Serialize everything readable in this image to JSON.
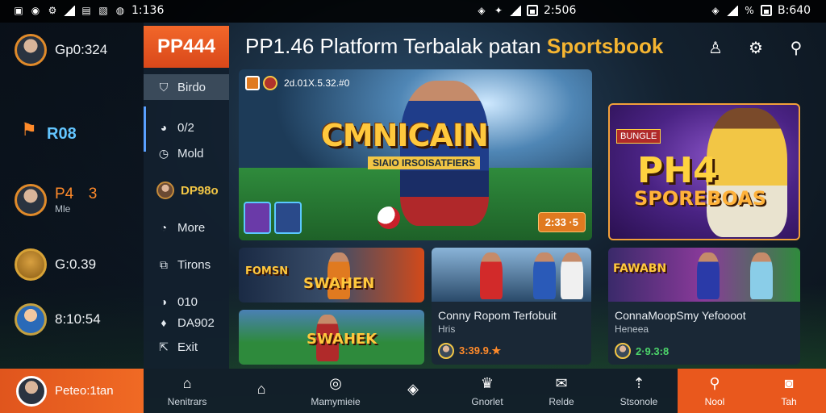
{
  "status_bar": {
    "left_time": "1:136",
    "mid_time": "2:506",
    "right_time": "B:640"
  },
  "left_rail": {
    "items": [
      {
        "value": "Gp0:324",
        "style": "plain"
      },
      {
        "value": "R08",
        "style": "amount"
      },
      {
        "value": "P4",
        "value2": "3",
        "sub": "Mle",
        "style": "orange"
      },
      {
        "value": "G:0.39",
        "style": "plain"
      },
      {
        "value": "8:10:54",
        "style": "plain"
      }
    ],
    "bottom_user": "Peteo:1tan"
  },
  "menu": {
    "brand": "PP444",
    "items": [
      {
        "label": "Birdo",
        "icon": "shield-icon"
      },
      {
        "label": "0/2",
        "icon": "chat-icon"
      },
      {
        "label": "Mold",
        "icon": "clock-icon"
      },
      {
        "label": "DP98o",
        "icon": "avatar-icon"
      },
      {
        "label": "More",
        "icon": "dots-icon"
      },
      {
        "label": "Tirons",
        "icon": "ticket-icon"
      },
      {
        "label": "010",
        "icon": "gift-icon"
      },
      {
        "label": "DA902",
        "icon": "bell-icon"
      },
      {
        "label": "Exit",
        "icon": "exit-icon"
      }
    ]
  },
  "header": {
    "title": "PP1.46 Platform Terbalak patan",
    "accent": "Sportsbook"
  },
  "hero": {
    "top_text": "2d.01X.5.32.#0",
    "title": "CMNICAIN",
    "subtitle": "SIAIO IRSOISATFIERS",
    "badge": "2:33 ·5"
  },
  "side_card": {
    "badge": "BUNGLE",
    "title": "PH4",
    "subtitle": "SPOREBOAS"
  },
  "tiles": {
    "t1": {
      "label": "SWAHEN",
      "label2": "FOMSN"
    },
    "t2": {
      "label": "SWAHEK"
    },
    "t3": {
      "title": "Conny Ropom Terfobuit",
      "sub": "Hris",
      "stat": "3:39.9.★"
    },
    "t4": {
      "label": "FAWABN",
      "title": "ConnaMoopSmy Yefoooot",
      "sub": "Heneea",
      "stat": "2·9.3:8"
    }
  },
  "bottom_nav": [
    {
      "label": "Nenitrars",
      "icon": "home-icon"
    },
    {
      "label": "",
      "icon": "house-icon"
    },
    {
      "label": "Mamymieie",
      "icon": "target-icon"
    },
    {
      "label": "",
      "icon": "compass-icon"
    },
    {
      "label": "Gnorlet",
      "icon": "trophy-icon"
    },
    {
      "label": "Relde",
      "icon": "chat-icon"
    },
    {
      "label": "Stsonole",
      "icon": "signal-icon"
    },
    {
      "label": "Nool",
      "icon": "search-icon",
      "hot": true
    },
    {
      "label": "Tah",
      "icon": "camera-icon",
      "hot": true
    }
  ]
}
